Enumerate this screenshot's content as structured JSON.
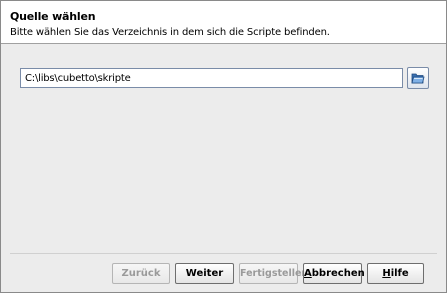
{
  "header": {
    "title": "Quelle wählen",
    "description": "Bitte wählen Sie das Verzeichnis in dem sich die Scripte befinden."
  },
  "source": {
    "path_value": "C:\\libs\\cubetto\\skripte",
    "browse_icon": "folder-open-icon"
  },
  "buttons": {
    "back": "Zurück",
    "next": "Weiter",
    "finish": "Fertigstellen",
    "cancel_mnemonic": "A",
    "cancel_rest": "bbrechen",
    "help_mnemonic": "H",
    "help_rest": "ilfe"
  },
  "colors": {
    "header_bg": "#ffffff",
    "body_bg": "#ececec",
    "input_border": "#7a8ca8",
    "disabled_text": "#9a9a9a"
  }
}
